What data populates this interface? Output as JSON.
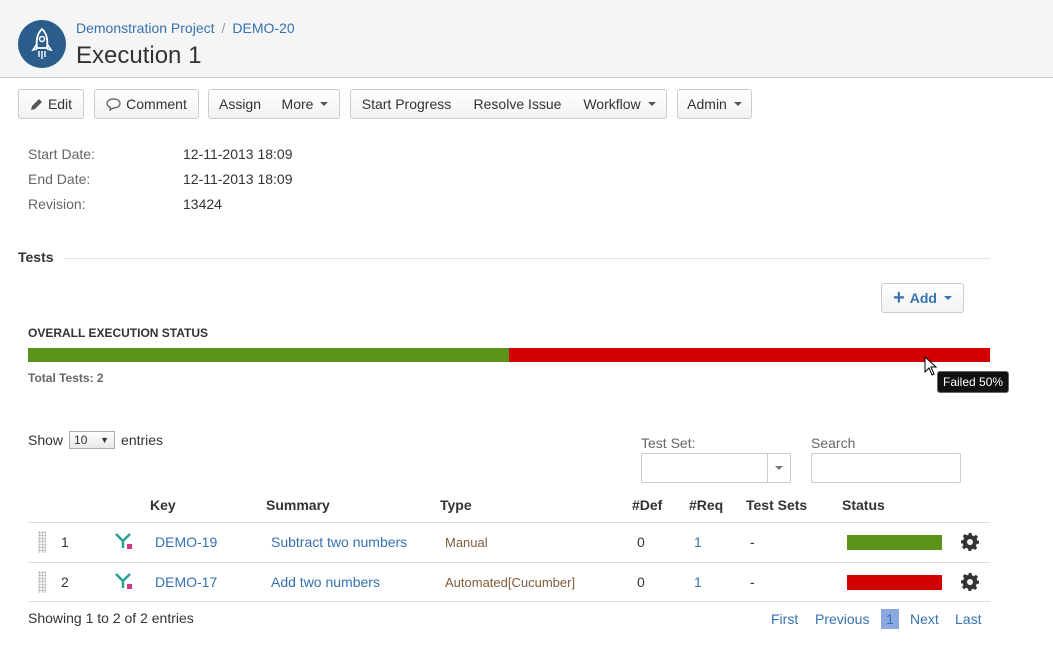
{
  "header": {
    "breadcrumb": [
      "Demonstration Project",
      "DEMO-20"
    ],
    "breadcrumb_sep": "/",
    "title": "Execution 1",
    "avatar_icon": "rocket-icon"
  },
  "toolbar": {
    "edit": "Edit",
    "comment": "Comment",
    "assign": "Assign",
    "more": "More",
    "start_progress": "Start Progress",
    "resolve_issue": "Resolve Issue",
    "workflow": "Workflow",
    "admin": "Admin"
  },
  "details": [
    {
      "label": "Start Date:",
      "value": "12-11-2013 18:09"
    },
    {
      "label": "End Date:",
      "value": "12-11-2013 18:09"
    },
    {
      "label": "Revision:",
      "value": "13424"
    }
  ],
  "tests": {
    "section_title": "Tests",
    "add_label": "Add",
    "overall_label": "OVERALL EXECUTION STATUS",
    "overall": [
      {
        "status": "Passed",
        "fraction": 0.5,
        "color": "#5b9219"
      },
      {
        "status": "Failed",
        "fraction": 0.5,
        "color": "#d20000"
      }
    ],
    "total_tests": "Total Tests: 2",
    "tooltip": "Failed 50%"
  },
  "controls": {
    "show_label": "Show",
    "entries_value": "10",
    "entries_label": "entries",
    "testset_label": "Test Set:",
    "search_label": "Search",
    "search_value": ""
  },
  "table": {
    "columns": [
      "Key",
      "Summary",
      "Type",
      "#Def",
      "#Req",
      "Test Sets",
      "Status"
    ],
    "rows": [
      {
        "rank": "1",
        "key": "DEMO-19",
        "summary": "Subtract two numbers",
        "type": "Manual",
        "def": "0",
        "req": "1",
        "test_sets": "-",
        "status_color": "#5b9219"
      },
      {
        "rank": "2",
        "key": "DEMO-17",
        "summary": "Add two numbers",
        "type": "Automated[Cucumber]",
        "def": "0",
        "req": "1",
        "test_sets": "-",
        "status_color": "#d20000"
      }
    ]
  },
  "footer": {
    "info": "Showing 1 to 2 of 2 entries",
    "first": "First",
    "previous": "Previous",
    "current_page": "1",
    "next": "Next",
    "last": "Last"
  },
  "colors": {
    "link": "#3572b0",
    "passed": "#5b9219",
    "failed": "#d20000"
  }
}
